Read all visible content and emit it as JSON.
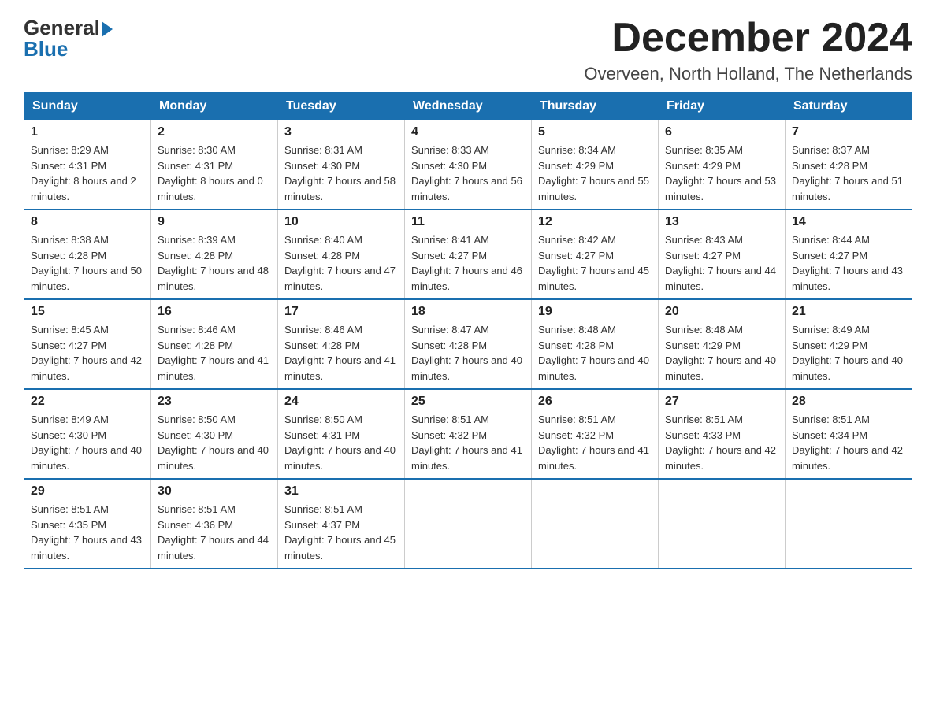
{
  "logo": {
    "general": "General",
    "blue": "Blue"
  },
  "header": {
    "month": "December 2024",
    "location": "Overveen, North Holland, The Netherlands"
  },
  "days_of_week": [
    "Sunday",
    "Monday",
    "Tuesday",
    "Wednesday",
    "Thursday",
    "Friday",
    "Saturday"
  ],
  "weeks": [
    [
      {
        "day": "1",
        "sunrise": "8:29 AM",
        "sunset": "4:31 PM",
        "daylight": "8 hours and 2 minutes."
      },
      {
        "day": "2",
        "sunrise": "8:30 AM",
        "sunset": "4:31 PM",
        "daylight": "8 hours and 0 minutes."
      },
      {
        "day": "3",
        "sunrise": "8:31 AM",
        "sunset": "4:30 PM",
        "daylight": "7 hours and 58 minutes."
      },
      {
        "day": "4",
        "sunrise": "8:33 AM",
        "sunset": "4:30 PM",
        "daylight": "7 hours and 56 minutes."
      },
      {
        "day": "5",
        "sunrise": "8:34 AM",
        "sunset": "4:29 PM",
        "daylight": "7 hours and 55 minutes."
      },
      {
        "day": "6",
        "sunrise": "8:35 AM",
        "sunset": "4:29 PM",
        "daylight": "7 hours and 53 minutes."
      },
      {
        "day": "7",
        "sunrise": "8:37 AM",
        "sunset": "4:28 PM",
        "daylight": "7 hours and 51 minutes."
      }
    ],
    [
      {
        "day": "8",
        "sunrise": "8:38 AM",
        "sunset": "4:28 PM",
        "daylight": "7 hours and 50 minutes."
      },
      {
        "day": "9",
        "sunrise": "8:39 AM",
        "sunset": "4:28 PM",
        "daylight": "7 hours and 48 minutes."
      },
      {
        "day": "10",
        "sunrise": "8:40 AM",
        "sunset": "4:28 PM",
        "daylight": "7 hours and 47 minutes."
      },
      {
        "day": "11",
        "sunrise": "8:41 AM",
        "sunset": "4:27 PM",
        "daylight": "7 hours and 46 minutes."
      },
      {
        "day": "12",
        "sunrise": "8:42 AM",
        "sunset": "4:27 PM",
        "daylight": "7 hours and 45 minutes."
      },
      {
        "day": "13",
        "sunrise": "8:43 AM",
        "sunset": "4:27 PM",
        "daylight": "7 hours and 44 minutes."
      },
      {
        "day": "14",
        "sunrise": "8:44 AM",
        "sunset": "4:27 PM",
        "daylight": "7 hours and 43 minutes."
      }
    ],
    [
      {
        "day": "15",
        "sunrise": "8:45 AM",
        "sunset": "4:27 PM",
        "daylight": "7 hours and 42 minutes."
      },
      {
        "day": "16",
        "sunrise": "8:46 AM",
        "sunset": "4:28 PM",
        "daylight": "7 hours and 41 minutes."
      },
      {
        "day": "17",
        "sunrise": "8:46 AM",
        "sunset": "4:28 PM",
        "daylight": "7 hours and 41 minutes."
      },
      {
        "day": "18",
        "sunrise": "8:47 AM",
        "sunset": "4:28 PM",
        "daylight": "7 hours and 40 minutes."
      },
      {
        "day": "19",
        "sunrise": "8:48 AM",
        "sunset": "4:28 PM",
        "daylight": "7 hours and 40 minutes."
      },
      {
        "day": "20",
        "sunrise": "8:48 AM",
        "sunset": "4:29 PM",
        "daylight": "7 hours and 40 minutes."
      },
      {
        "day": "21",
        "sunrise": "8:49 AM",
        "sunset": "4:29 PM",
        "daylight": "7 hours and 40 minutes."
      }
    ],
    [
      {
        "day": "22",
        "sunrise": "8:49 AM",
        "sunset": "4:30 PM",
        "daylight": "7 hours and 40 minutes."
      },
      {
        "day": "23",
        "sunrise": "8:50 AM",
        "sunset": "4:30 PM",
        "daylight": "7 hours and 40 minutes."
      },
      {
        "day": "24",
        "sunrise": "8:50 AM",
        "sunset": "4:31 PM",
        "daylight": "7 hours and 40 minutes."
      },
      {
        "day": "25",
        "sunrise": "8:51 AM",
        "sunset": "4:32 PM",
        "daylight": "7 hours and 41 minutes."
      },
      {
        "day": "26",
        "sunrise": "8:51 AM",
        "sunset": "4:32 PM",
        "daylight": "7 hours and 41 minutes."
      },
      {
        "day": "27",
        "sunrise": "8:51 AM",
        "sunset": "4:33 PM",
        "daylight": "7 hours and 42 minutes."
      },
      {
        "day": "28",
        "sunrise": "8:51 AM",
        "sunset": "4:34 PM",
        "daylight": "7 hours and 42 minutes."
      }
    ],
    [
      {
        "day": "29",
        "sunrise": "8:51 AM",
        "sunset": "4:35 PM",
        "daylight": "7 hours and 43 minutes."
      },
      {
        "day": "30",
        "sunrise": "8:51 AM",
        "sunset": "4:36 PM",
        "daylight": "7 hours and 44 minutes."
      },
      {
        "day": "31",
        "sunrise": "8:51 AM",
        "sunset": "4:37 PM",
        "daylight": "7 hours and 45 minutes."
      },
      null,
      null,
      null,
      null
    ]
  ]
}
